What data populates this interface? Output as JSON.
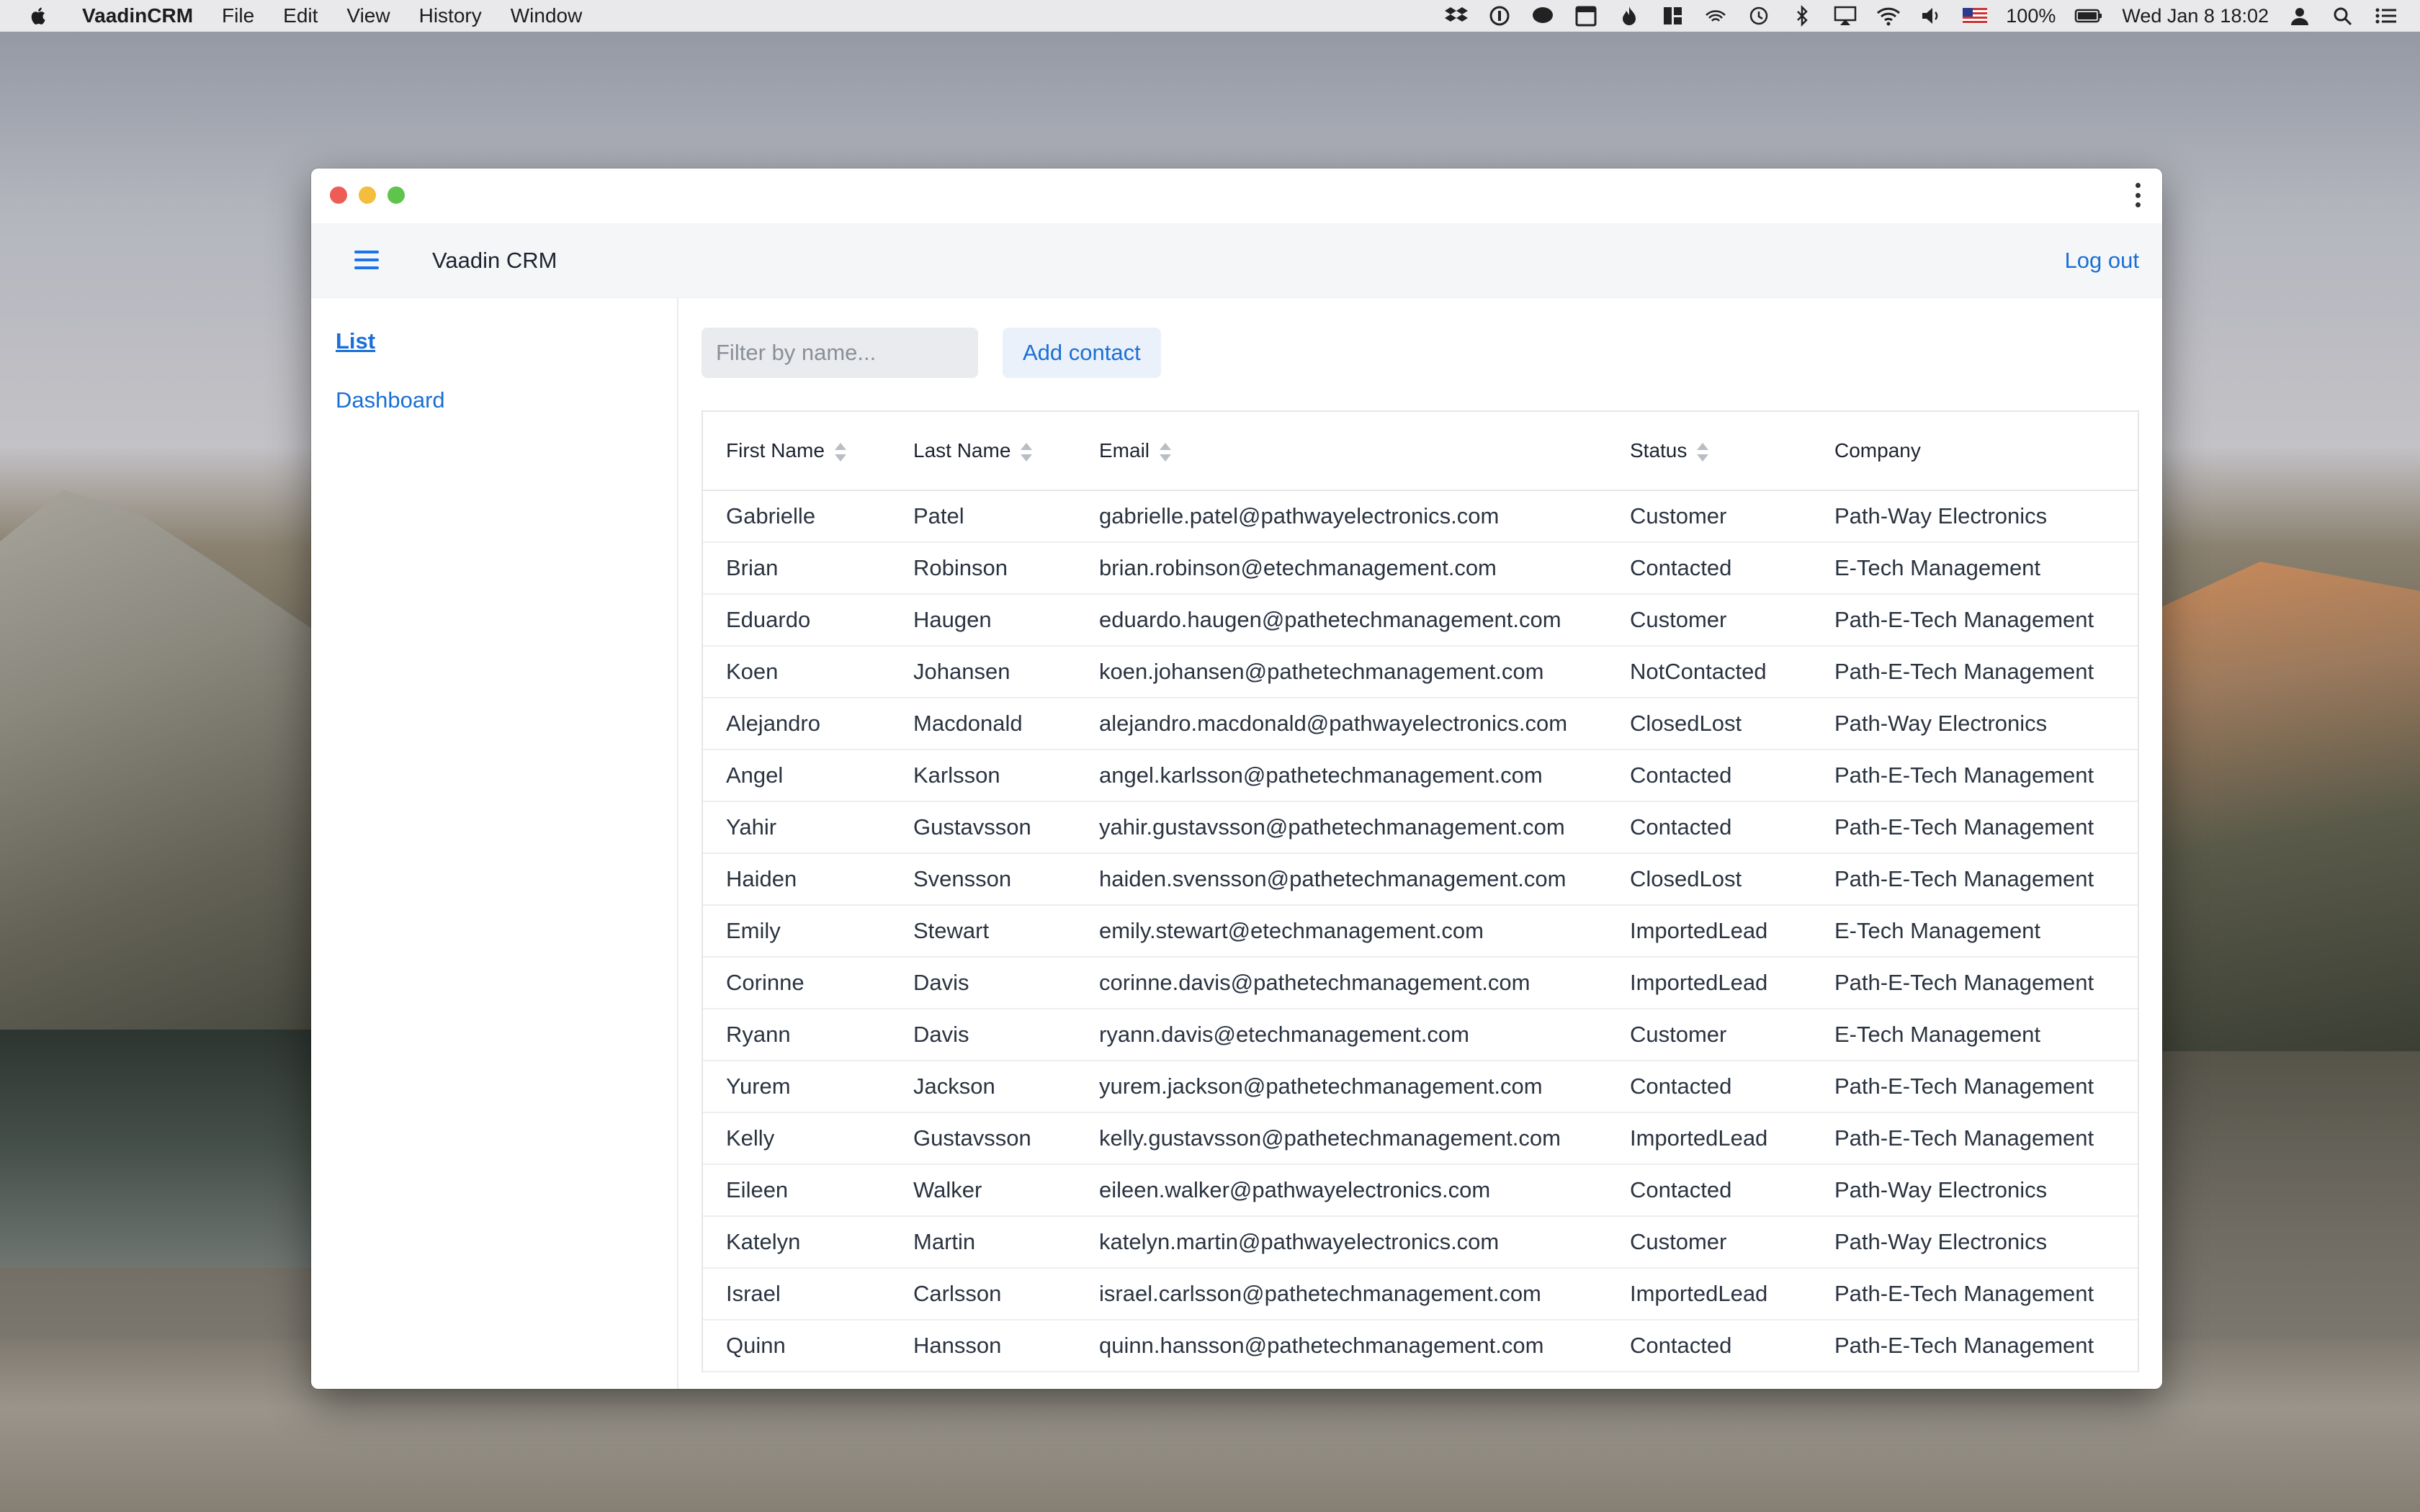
{
  "menubar": {
    "app_name": "VaadinCRM",
    "menus": [
      "File",
      "Edit",
      "View",
      "History",
      "Window"
    ],
    "battery": "100%",
    "clock": "Wed Jan 8  18:02"
  },
  "header": {
    "title": "Vaadin CRM",
    "logout_label": "Log out"
  },
  "nav": {
    "items": [
      {
        "label": "List",
        "active": true
      },
      {
        "label": "Dashboard",
        "active": false
      }
    ]
  },
  "toolbar": {
    "filter_placeholder": "Filter by name...",
    "add_label": "Add contact"
  },
  "grid": {
    "columns": [
      "First Name",
      "Last Name",
      "Email",
      "Status",
      "Company"
    ],
    "rows": [
      [
        "Gabrielle",
        "Patel",
        "gabrielle.patel@pathwayelectronics.com",
        "Customer",
        "Path-Way Electronics"
      ],
      [
        "Brian",
        "Robinson",
        "brian.robinson@etechmanagement.com",
        "Contacted",
        "E-Tech Management"
      ],
      [
        "Eduardo",
        "Haugen",
        "eduardo.haugen@pathetechmanagement.com",
        "Customer",
        "Path-E-Tech Management"
      ],
      [
        "Koen",
        "Johansen",
        "koen.johansen@pathetechmanagement.com",
        "NotContacted",
        "Path-E-Tech Management"
      ],
      [
        "Alejandro",
        "Macdonald",
        "alejandro.macdonald@pathwayelectronics.com",
        "ClosedLost",
        "Path-Way Electronics"
      ],
      [
        "Angel",
        "Karlsson",
        "angel.karlsson@pathetechmanagement.com",
        "Contacted",
        "Path-E-Tech Management"
      ],
      [
        "Yahir",
        "Gustavsson",
        "yahir.gustavsson@pathetechmanagement.com",
        "Contacted",
        "Path-E-Tech Management"
      ],
      [
        "Haiden",
        "Svensson",
        "haiden.svensson@pathetechmanagement.com",
        "ClosedLost",
        "Path-E-Tech Management"
      ],
      [
        "Emily",
        "Stewart",
        "emily.stewart@etechmanagement.com",
        "ImportedLead",
        "E-Tech Management"
      ],
      [
        "Corinne",
        "Davis",
        "corinne.davis@pathetechmanagement.com",
        "ImportedLead",
        "Path-E-Tech Management"
      ],
      [
        "Ryann",
        "Davis",
        "ryann.davis@etechmanagement.com",
        "Customer",
        "E-Tech Management"
      ],
      [
        "Yurem",
        "Jackson",
        "yurem.jackson@pathetechmanagement.com",
        "Contacted",
        "Path-E-Tech Management"
      ],
      [
        "Kelly",
        "Gustavsson",
        "kelly.gustavsson@pathetechmanagement.com",
        "ImportedLead",
        "Path-E-Tech Management"
      ],
      [
        "Eileen",
        "Walker",
        "eileen.walker@pathwayelectronics.com",
        "Contacted",
        "Path-Way Electronics"
      ],
      [
        "Katelyn",
        "Martin",
        "katelyn.martin@pathwayelectronics.com",
        "Customer",
        "Path-Way Electronics"
      ],
      [
        "Israel",
        "Carlsson",
        "israel.carlsson@pathetechmanagement.com",
        "ImportedLead",
        "Path-E-Tech Management"
      ],
      [
        "Quinn",
        "Hansson",
        "quinn.hansson@pathetechmanagement.com",
        "Contacted",
        "Path-E-Tech Management"
      ]
    ]
  },
  "colors": {
    "accent": "#1a6fd6",
    "header_bg": "#f5f6f8"
  }
}
